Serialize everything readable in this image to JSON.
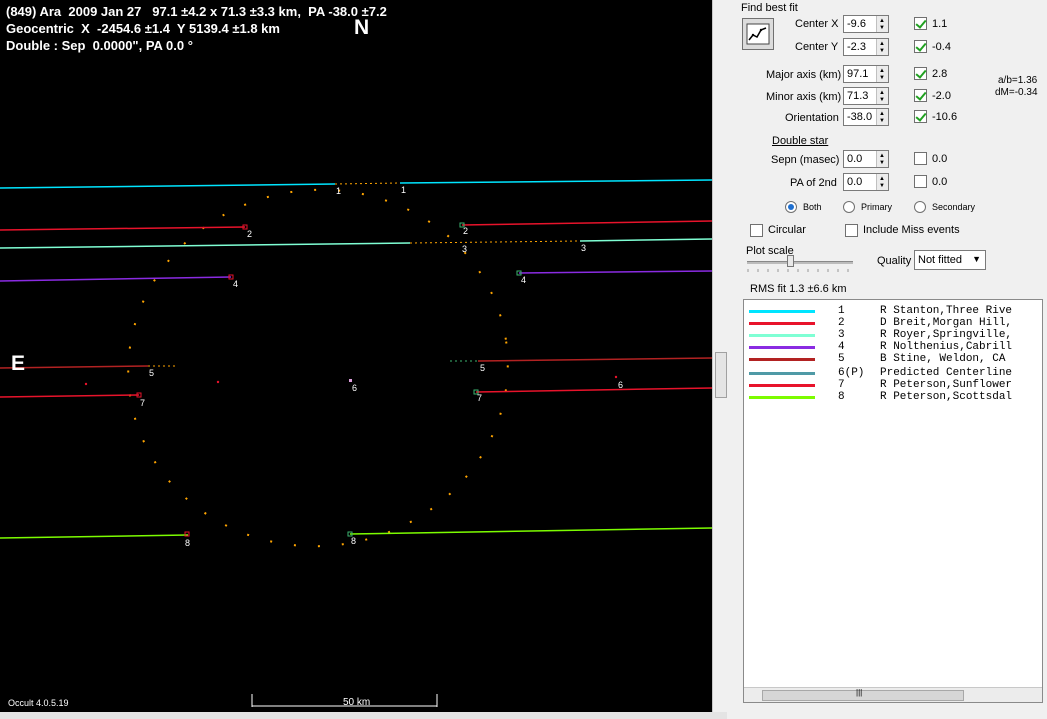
{
  "header": {
    "line1": "(849) Ara  2009 Jan 27   97.1 ±4.2 x 71.3 ±3.3 km,  PA -38.0 ±7.2",
    "line2": "Geocentric  X  -2454.6 ±1.4  Y 5139.4 ±1.8 km",
    "line3": "Double : Sep  0.0000\", PA 0.0 °"
  },
  "compass": {
    "north": "N",
    "east": "E"
  },
  "footer": {
    "version": "Occult 4.0.5.19",
    "scale_label": "50 km"
  },
  "plot": {
    "chord_labels": [
      "1",
      "1",
      "2",
      "2",
      "3",
      "3",
      "4",
      "4",
      "5",
      "5",
      "6",
      "6",
      "7",
      "7",
      "8",
      "8"
    ],
    "chord_colors": {
      "1": "#00e5ff",
      "2": "#e8132b",
      "3": "#7fffd4",
      "4": "#8a2be2",
      "5": "#b22222",
      "6": "#4f9aa6",
      "7": "#e8132b",
      "8": "#7cfc00"
    },
    "outline_color": "#ffa500"
  },
  "panel": {
    "find_best_fit": "Find best fit",
    "center_x": {
      "label": "Center X",
      "value": "-9.6",
      "fit_checked": true,
      "result": "1.1"
    },
    "center_y": {
      "label": "Center Y",
      "value": "-2.3",
      "fit_checked": true,
      "result": "-0.4"
    },
    "major": {
      "label": "Major axis (km)",
      "value": "97.1",
      "fit_checked": true,
      "result": "2.8"
    },
    "minor": {
      "label": "Minor axis (km)",
      "value": "71.3",
      "fit_checked": true,
      "result": "-2.0"
    },
    "orientation": {
      "label": "Orientation",
      "value": "-38.0",
      "fit_checked": true,
      "result": "-10.6"
    },
    "ratio": "a/b=1.36",
    "dm": "dM=-0.34",
    "double_star": "Double star",
    "sepn": {
      "label": "Sepn (masec)",
      "value": "0.0",
      "fit_checked": false,
      "result": "0.0"
    },
    "pa2": {
      "label": "PA of 2nd",
      "value": "0.0",
      "fit_checked": false,
      "result": "0.0"
    },
    "radio": {
      "both": "Both",
      "primary": "Primary",
      "secondary": "Secondary",
      "selected": "Both"
    },
    "circular": "Circular",
    "include_miss": "Include Miss events",
    "plot_scale": "Plot scale",
    "quality_label": "Quality",
    "quality_value": "Not fitted",
    "rms": "RMS fit  1.3 ±6.6 km"
  },
  "legend": [
    {
      "num": "1",
      "text": "R Stanton,Three Rive",
      "color": "#00e5ff"
    },
    {
      "num": "2",
      "text": "D Breit,Morgan Hill,",
      "color": "#e8132b"
    },
    {
      "num": "3",
      "text": "R Royer,Springville,",
      "color": "#7fffd4"
    },
    {
      "num": "4",
      "text": "R Nolthenius,Cabrill",
      "color": "#8a2be2"
    },
    {
      "num": "5",
      "text": "B Stine, Weldon, CA",
      "color": "#b22222"
    },
    {
      "num": "6(P)",
      "text": "Predicted Centerline",
      "color": "#4f9aa6"
    },
    {
      "num": "7",
      "text": "R Peterson,Sunflower",
      "color": "#e8132b"
    },
    {
      "num": "8",
      "text": "R Peterson,Scottsdal",
      "color": "#7cfc00"
    }
  ]
}
